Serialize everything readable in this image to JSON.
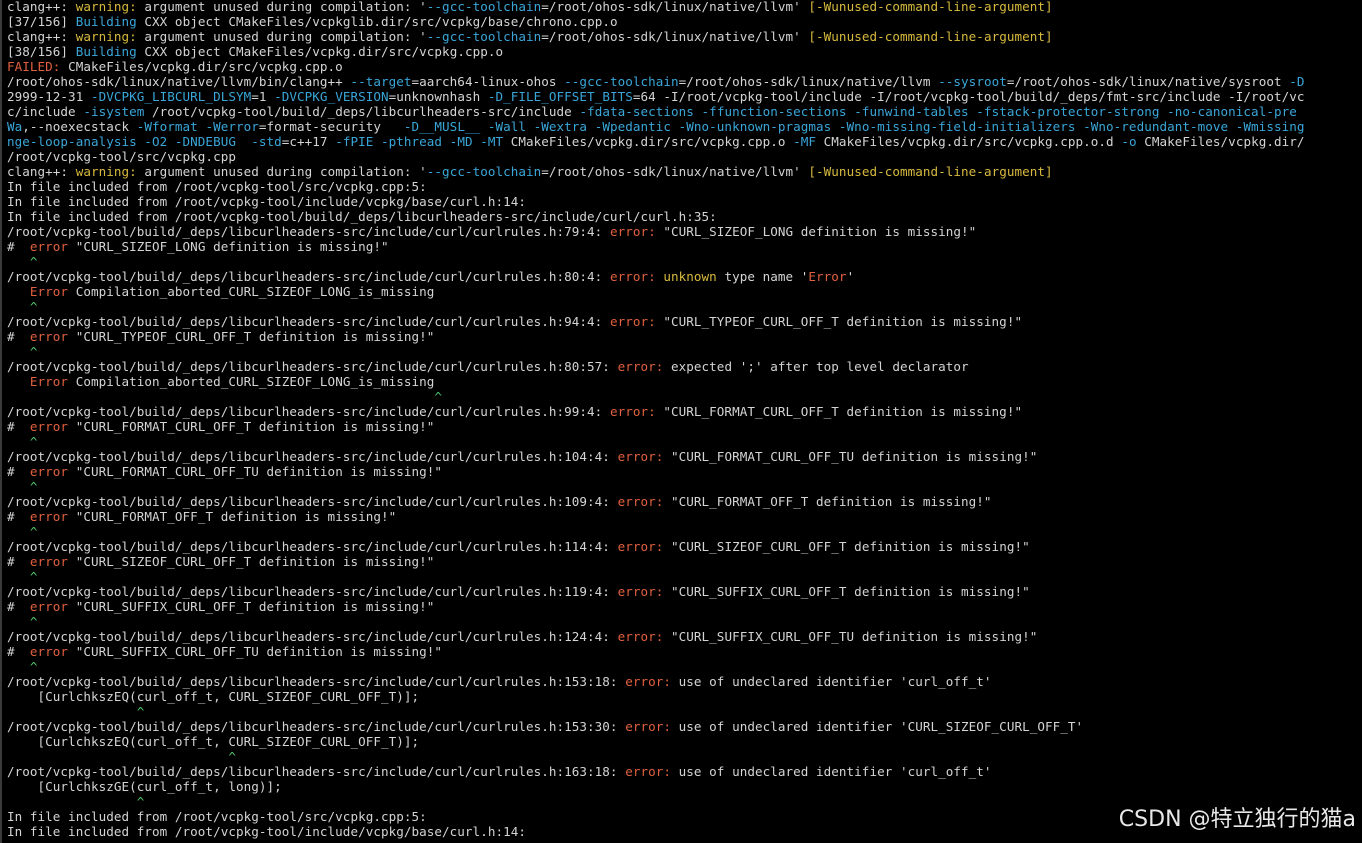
{
  "terminal": {
    "lines": [
      [
        [
          "normal",
          "clang++: "
        ],
        [
          "warning",
          "warning: "
        ],
        [
          "normal",
          "argument unused during compilation: '"
        ],
        [
          "cyan",
          "--gcc-toolchain"
        ],
        [
          "normal",
          "=/root/ohos-sdk/linux/native/llvm' "
        ],
        [
          "warning",
          "[-Wunused-command-line-argument]"
        ]
      ],
      [
        [
          "normal",
          "[37/156] "
        ],
        [
          "cyan",
          "Building "
        ],
        [
          "normal",
          "CXX object CMakeFiles/vcpkglib.dir/src/vcpkg/base/chrono.cpp.o"
        ]
      ],
      [
        [
          "normal",
          "clang++: "
        ],
        [
          "warning",
          "warning: "
        ],
        [
          "normal",
          "argument unused during compilation: '"
        ],
        [
          "cyan",
          "--gcc-toolchain"
        ],
        [
          "normal",
          "=/root/ohos-sdk/linux/native/llvm' "
        ],
        [
          "warning",
          "[-Wunused-command-line-argument]"
        ]
      ],
      [
        [
          "normal",
          "[38/156] "
        ],
        [
          "cyan",
          "Building "
        ],
        [
          "normal",
          "CXX object CMakeFiles/vcpkg.dir/src/vcpkg.cpp.o"
        ]
      ],
      [
        [
          "failed",
          "FAILED: "
        ],
        [
          "normal",
          "CMakeFiles/vcpkg.dir/src/vcpkg.cpp.o"
        ]
      ],
      [
        [
          "normal",
          "/root/ohos-sdk/linux/native/llvm/bin/clang++ "
        ],
        [
          "flag",
          "--target"
        ],
        [
          "normal",
          "=aarch64-linux-ohos "
        ],
        [
          "flag",
          "--gcc-toolchain"
        ],
        [
          "normal",
          "=/root/ohos-sdk/linux/native/llvm "
        ],
        [
          "flag",
          "--sysroot"
        ],
        [
          "normal",
          "=/root/ohos-sdk/linux/native/sysroot "
        ],
        [
          "flag",
          "-D"
        ]
      ],
      [
        [
          "normal",
          "2999-12-31 "
        ],
        [
          "flag",
          "-DVCPKG_LIBCURL_DLSYM"
        ],
        [
          "normal",
          "=1 "
        ],
        [
          "flag",
          "-DVCPKG_VERSION"
        ],
        [
          "normal",
          "=unknownhash "
        ],
        [
          "flag",
          "-D_FILE_OFFSET_BITS"
        ],
        [
          "normal",
          "=64 -I/root/vcpkg-tool/include -I/root/vcpkg-tool/build/_deps/fmt-src/include -I/root/vc"
        ]
      ],
      [
        [
          "normal",
          "c/include "
        ],
        [
          "flag",
          "-isystem "
        ],
        [
          "normal",
          "/root/vcpkg-tool/build/_deps/libcurlheaders-src/include "
        ],
        [
          "flag",
          "-fdata-sections -ffunction-sections -funwind-tables -fstack-protector-strong -no-canonical-pre"
        ]
      ],
      [
        [
          "flag",
          "Wa"
        ],
        [
          "normal",
          ",--noexecstack "
        ],
        [
          "flag",
          "-Wformat -Werror"
        ],
        [
          "normal",
          "=format-security   "
        ],
        [
          "flag",
          "-D__MUSL__ -Wall -Wextra -Wpedantic -Wno-unknown-pragmas -Wno-missing-field-initializers -Wno-redundant-move -Wmissing"
        ]
      ],
      [
        [
          "flag",
          "nge-loop-analysis -O2 -DNDEBUG  -std"
        ],
        [
          "normal",
          "=c++17 "
        ],
        [
          "flag",
          "-fPIE -pthread -MD -MT "
        ],
        [
          "normal",
          "CMakeFiles/vcpkg.dir/src/vcpkg.cpp.o "
        ],
        [
          "flag",
          "-MF "
        ],
        [
          "normal",
          "CMakeFiles/vcpkg.dir/src/vcpkg.cpp.o.d "
        ],
        [
          "flag",
          "-o "
        ],
        [
          "normal",
          "CMakeFiles/vcpkg.dir/"
        ]
      ],
      [
        [
          "normal",
          "/root/vcpkg-tool/src/vcpkg.cpp"
        ]
      ],
      [
        [
          "normal",
          "clang++: "
        ],
        [
          "warning",
          "warning: "
        ],
        [
          "normal",
          "argument unused during compilation: '"
        ],
        [
          "cyan",
          "--gcc-toolchain"
        ],
        [
          "normal",
          "=/root/ohos-sdk/linux/native/llvm' "
        ],
        [
          "warning",
          "[-Wunused-command-line-argument]"
        ]
      ],
      [
        [
          "normal",
          "In file included from /root/vcpkg-tool/src/vcpkg.cpp:5:"
        ]
      ],
      [
        [
          "normal",
          "In file included from /root/vcpkg-tool/include/vcpkg/base/curl.h:14:"
        ]
      ],
      [
        [
          "normal",
          "In file included from /root/vcpkg-tool/build/_deps/libcurlheaders-src/include/curl/curl.h:35:"
        ]
      ],
      [
        [
          "normal",
          "/root/vcpkg-tool/build/_deps/libcurlheaders-src/include/curl/curlrules.h:79:4: "
        ],
        [
          "error",
          "error: "
        ],
        [
          "normal",
          "\"CURL_SIZEOF_LONG definition is missing!\""
        ]
      ],
      [
        [
          "normal",
          "#  "
        ],
        [
          "error",
          "error "
        ],
        [
          "normal",
          "\"CURL_SIZEOF_LONG definition is missing!\""
        ]
      ],
      [
        [
          "caret",
          "   ^"
        ]
      ],
      [
        [
          "normal",
          "/root/vcpkg-tool/build/_deps/libcurlheaders-src/include/curl/curlrules.h:80:4: "
        ],
        [
          "error",
          "error: "
        ],
        [
          "warning",
          "unknown "
        ],
        [
          "normal",
          "type name '"
        ],
        [
          "error",
          "Error"
        ],
        [
          "normal",
          "'"
        ]
      ],
      [
        [
          "normal",
          "   "
        ],
        [
          "error",
          "Error "
        ],
        [
          "normal",
          "Compilation_aborted_CURL_SIZEOF_LONG_is_missing"
        ]
      ],
      [
        [
          "caret",
          "   ^"
        ]
      ],
      [
        [
          "normal",
          "/root/vcpkg-tool/build/_deps/libcurlheaders-src/include/curl/curlrules.h:94:4: "
        ],
        [
          "error",
          "error: "
        ],
        [
          "normal",
          "\"CURL_TYPEOF_CURL_OFF_T definition is missing!\""
        ]
      ],
      [
        [
          "normal",
          "#  "
        ],
        [
          "error",
          "error "
        ],
        [
          "normal",
          "\"CURL_TYPEOF_CURL_OFF_T definition is missing!\""
        ]
      ],
      [
        [
          "caret",
          "   ^"
        ]
      ],
      [
        [
          "normal",
          "/root/vcpkg-tool/build/_deps/libcurlheaders-src/include/curl/curlrules.h:80:57: "
        ],
        [
          "error",
          "error: "
        ],
        [
          "normal",
          "expected ';' after top level declarator"
        ]
      ],
      [
        [
          "normal",
          "   "
        ],
        [
          "error",
          "Error "
        ],
        [
          "normal",
          "Compilation_aborted_CURL_SIZEOF_LONG_is_missing"
        ]
      ],
      [
        [
          "caret",
          "                                                        ^"
        ]
      ],
      [
        [
          "normal",
          "/root/vcpkg-tool/build/_deps/libcurlheaders-src/include/curl/curlrules.h:99:4: "
        ],
        [
          "error",
          "error: "
        ],
        [
          "normal",
          "\"CURL_FORMAT_CURL_OFF_T definition is missing!\""
        ]
      ],
      [
        [
          "normal",
          "#  "
        ],
        [
          "error",
          "error "
        ],
        [
          "normal",
          "\"CURL_FORMAT_CURL_OFF_T definition is missing!\""
        ]
      ],
      [
        [
          "caret",
          "   ^"
        ]
      ],
      [
        [
          "normal",
          "/root/vcpkg-tool/build/_deps/libcurlheaders-src/include/curl/curlrules.h:104:4: "
        ],
        [
          "error",
          "error: "
        ],
        [
          "normal",
          "\"CURL_FORMAT_CURL_OFF_TU definition is missing!\""
        ]
      ],
      [
        [
          "normal",
          "#  "
        ],
        [
          "error",
          "error "
        ],
        [
          "normal",
          "\"CURL_FORMAT_CURL_OFF_TU definition is missing!\""
        ]
      ],
      [
        [
          "caret",
          "   ^"
        ]
      ],
      [
        [
          "normal",
          "/root/vcpkg-tool/build/_deps/libcurlheaders-src/include/curl/curlrules.h:109:4: "
        ],
        [
          "error",
          "error: "
        ],
        [
          "normal",
          "\"CURL_FORMAT_OFF_T definition is missing!\""
        ]
      ],
      [
        [
          "normal",
          "#  "
        ],
        [
          "error",
          "error "
        ],
        [
          "normal",
          "\"CURL_FORMAT_OFF_T definition is missing!\""
        ]
      ],
      [
        [
          "caret",
          "   ^"
        ]
      ],
      [
        [
          "normal",
          "/root/vcpkg-tool/build/_deps/libcurlheaders-src/include/curl/curlrules.h:114:4: "
        ],
        [
          "error",
          "error: "
        ],
        [
          "normal",
          "\"CURL_SIZEOF_CURL_OFF_T definition is missing!\""
        ]
      ],
      [
        [
          "normal",
          "#  "
        ],
        [
          "error",
          "error "
        ],
        [
          "normal",
          "\"CURL_SIZEOF_CURL_OFF_T definition is missing!\""
        ]
      ],
      [
        [
          "caret",
          "   ^"
        ]
      ],
      [
        [
          "normal",
          "/root/vcpkg-tool/build/_deps/libcurlheaders-src/include/curl/curlrules.h:119:4: "
        ],
        [
          "error",
          "error: "
        ],
        [
          "normal",
          "\"CURL_SUFFIX_CURL_OFF_T definition is missing!\""
        ]
      ],
      [
        [
          "normal",
          "#  "
        ],
        [
          "error",
          "error "
        ],
        [
          "normal",
          "\"CURL_SUFFIX_CURL_OFF_T definition is missing!\""
        ]
      ],
      [
        [
          "caret",
          "   ^"
        ]
      ],
      [
        [
          "normal",
          "/root/vcpkg-tool/build/_deps/libcurlheaders-src/include/curl/curlrules.h:124:4: "
        ],
        [
          "error",
          "error: "
        ],
        [
          "normal",
          "\"CURL_SUFFIX_CURL_OFF_TU definition is missing!\""
        ]
      ],
      [
        [
          "normal",
          "#  "
        ],
        [
          "error",
          "error "
        ],
        [
          "normal",
          "\"CURL_SUFFIX_CURL_OFF_TU definition is missing!\""
        ]
      ],
      [
        [
          "caret",
          "   ^"
        ]
      ],
      [
        [
          "normal",
          "/root/vcpkg-tool/build/_deps/libcurlheaders-src/include/curl/curlrules.h:153:18: "
        ],
        [
          "error",
          "error: "
        ],
        [
          "normal",
          "use of undeclared identifier 'curl_off_t'"
        ]
      ],
      [
        [
          "normal",
          "    [CurlchkszEQ(curl_off_t, CURL_SIZEOF_CURL_OFF_T)];"
        ]
      ],
      [
        [
          "caret",
          "                 ^"
        ]
      ],
      [
        [
          "normal",
          "/root/vcpkg-tool/build/_deps/libcurlheaders-src/include/curl/curlrules.h:153:30: "
        ],
        [
          "error",
          "error: "
        ],
        [
          "normal",
          "use of undeclared identifier 'CURL_SIZEOF_CURL_OFF_T'"
        ]
      ],
      [
        [
          "normal",
          "    [CurlchkszEQ(curl_off_t, CURL_SIZEOF_CURL_OFF_T)];"
        ]
      ],
      [
        [
          "caret",
          "                             ^"
        ]
      ],
      [
        [
          "normal",
          "/root/vcpkg-tool/build/_deps/libcurlheaders-src/include/curl/curlrules.h:163:18: "
        ],
        [
          "error",
          "error: "
        ],
        [
          "normal",
          "use of undeclared identifier 'curl_off_t'"
        ]
      ],
      [
        [
          "normal",
          "    [CurlchkszGE(curl_off_t, long)];"
        ]
      ],
      [
        [
          "caret",
          "                 ^"
        ]
      ],
      [
        [
          "normal",
          "In file included from /root/vcpkg-tool/src/vcpkg.cpp:5:"
        ]
      ],
      [
        [
          "normal",
          "In file included from /root/vcpkg-tool/include/vcpkg/base/curl.h:14:"
        ]
      ]
    ]
  },
  "watermark": "CSDN @特立独行的猫a"
}
